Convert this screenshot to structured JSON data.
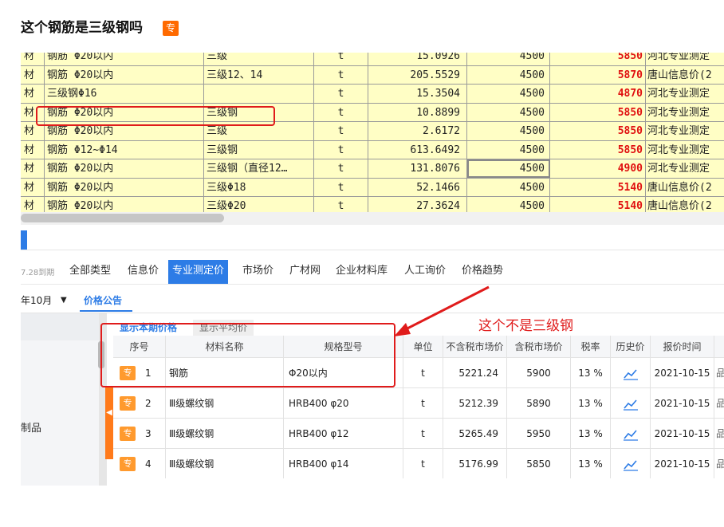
{
  "title": "这个钢筋是三级钢吗",
  "title_badge": "专",
  "sheet": {
    "rows": [
      {
        "c0": "材",
        "name": "钢筋 Φ20以内",
        "spec": "三级",
        "unit": "t",
        "qty": "15.0926",
        "base": "4500",
        "price": "5850",
        "source": "河北专业测定"
      },
      {
        "c0": "材",
        "name": "钢筋 Φ20以内",
        "spec": "三级12、14",
        "unit": "t",
        "qty": "205.5529",
        "base": "4500",
        "price": "5870",
        "source": "唐山信息价(2"
      },
      {
        "c0": "材",
        "name": "三级钢Φ16",
        "spec": "",
        "unit": "t",
        "qty": "15.3504",
        "base": "4500",
        "price": "4870",
        "source": "河北专业测定"
      },
      {
        "c0": "材",
        "name": "钢筋 Φ20以内",
        "spec": "三级钢",
        "unit": "t",
        "qty": "10.8899",
        "base": "4500",
        "price": "5850",
        "source": "河北专业测定"
      },
      {
        "c0": "材",
        "name": "钢筋 Φ20以内",
        "spec": "三级",
        "unit": "t",
        "qty": "2.6172",
        "base": "4500",
        "price": "5850",
        "source": "河北专业测定"
      },
      {
        "c0": "材",
        "name": "钢筋 Φ12~Φ14",
        "spec": "三级钢",
        "unit": "t",
        "qty": "613.6492",
        "base": "4500",
        "price": "5850",
        "source": "河北专业测定"
      },
      {
        "c0": "材",
        "name": "钢筋 Φ20以内",
        "spec": "三级钢（直径12…",
        "unit": "t",
        "qty": "131.8076",
        "base": "4500",
        "price": "4900",
        "source": "河北专业测定"
      },
      {
        "c0": "材",
        "name": "钢筋 Φ20以内",
        "spec": "三级Φ18",
        "unit": "t",
        "qty": "52.1466",
        "base": "4500",
        "price": "5140",
        "source": "唐山信息价(2"
      },
      {
        "c0": "材",
        "name": "钢筋 Φ20以内",
        "spec": "三级Φ20",
        "unit": "t",
        "qty": "27.3624",
        "base": "4500",
        "price": "5140",
        "source": "唐山信息价(2"
      }
    ]
  },
  "tabs": {
    "expire": "7.28到期",
    "items": [
      "全部类型",
      "信息价",
      "专业测定价",
      "市场价",
      "广材网",
      "企业材料库",
      "人工询价",
      "价格趋势"
    ],
    "active": "专业测定价"
  },
  "filter": {
    "month": "年10月",
    "announce": "价格公告"
  },
  "left_panel": {
    "category": "制品"
  },
  "subtabs": {
    "current": "显示本期价格",
    "average": "显示平均价"
  },
  "table": {
    "headers": [
      "序号",
      "材料名称",
      "规格型号",
      "单位",
      "不含税市场价",
      "含税市场价",
      "税率",
      "历史价",
      "报价时间"
    ],
    "rows": [
      {
        "badge": "专",
        "no": "1",
        "name": "钢筋",
        "spec": "Φ20以内",
        "unit": "t",
        "ex_tax": "5221.24",
        "in_tax": "5900",
        "rate": "13 %",
        "date": "2021-10-15",
        "extra": "品"
      },
      {
        "badge": "专",
        "no": "2",
        "name": "Ⅲ级螺纹钢",
        "spec": "HRB400 φ20",
        "unit": "t",
        "ex_tax": "5212.39",
        "in_tax": "5890",
        "rate": "13 %",
        "date": "2021-10-15",
        "extra": "品"
      },
      {
        "badge": "专",
        "no": "3",
        "name": "Ⅲ级螺纹钢",
        "spec": "HRB400 φ12",
        "unit": "t",
        "ex_tax": "5265.49",
        "in_tax": "5950",
        "rate": "13 %",
        "date": "2021-10-15",
        "extra": "品"
      },
      {
        "badge": "专",
        "no": "4",
        "name": "Ⅲ级螺纹钢",
        "spec": "HRB400 φ14",
        "unit": "t",
        "ex_tax": "5176.99",
        "in_tax": "5850",
        "rate": "13 %",
        "date": "2021-10-15",
        "extra": "品"
      }
    ]
  },
  "annotation": "这个不是三级钢",
  "colors": {
    "accent": "#2d7ce6",
    "highlight": "#fffec5",
    "price_red": "#e01010",
    "annotation_red": "#e01b1b",
    "badge_orange": "#ff9a2e"
  },
  "icons": {
    "history": "line-chart-icon",
    "dropdown": "caret-down-icon"
  }
}
